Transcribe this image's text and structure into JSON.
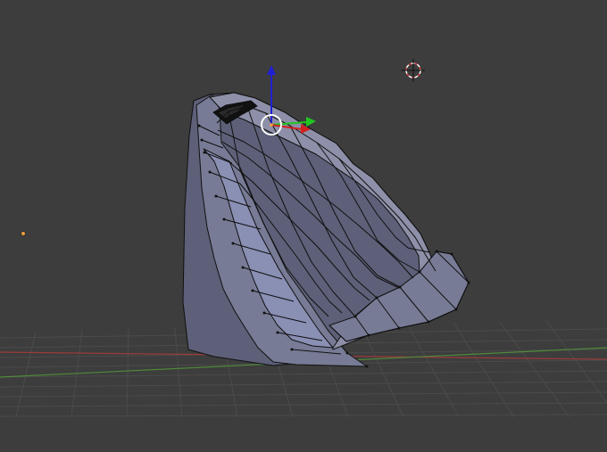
{
  "viewport": {
    "background": "#3d3d3d",
    "grid_line": "#4b4b4b",
    "x_axis": "#9a3b3b",
    "y_axis": "#4f8a3a",
    "mesh_face": "#777b95",
    "mesh_face_light": "#8d90a8",
    "mesh_face_dark": "#5d6078",
    "mesh_inner": "#8a8fb4",
    "mesh_edge": "#101010",
    "vertex": "#111111"
  },
  "objects": {
    "mesh": "selected-mesh",
    "cursor": "3d-cursor",
    "lamp": "lamp-origin",
    "gizmo": "translate-manipulator"
  },
  "gizmo_axes": {
    "x": "#d22020",
    "y": "#21c521",
    "z": "#2020d2"
  }
}
